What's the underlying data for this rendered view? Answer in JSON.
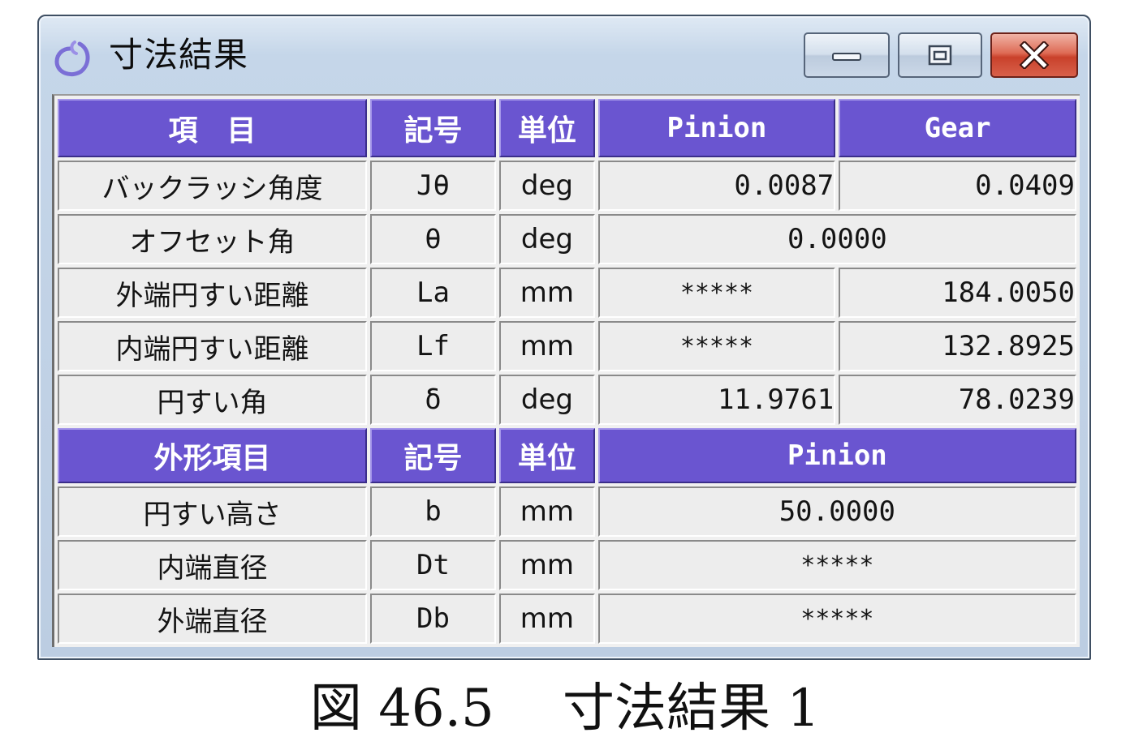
{
  "window": {
    "title": "寸法結果",
    "icon": "app-icon"
  },
  "controls": {
    "minimize": "minimize-icon",
    "maximize": "restore-icon",
    "close": "close-icon"
  },
  "table1": {
    "headers": [
      "項　目",
      "記号",
      "単位",
      "Pinion",
      "Gear"
    ],
    "rows": [
      {
        "item": "バックラッシ角度",
        "symbol": "Jθ",
        "unit": "deg",
        "pinion": "0.0087",
        "gear": "0.0409"
      },
      {
        "item": "オフセット角",
        "symbol": "θ",
        "unit": "deg",
        "merged": "0.0000"
      },
      {
        "item": "外端円すい距離",
        "symbol": "La",
        "unit": "mm",
        "pinion": "*****",
        "gear": "184.0050"
      },
      {
        "item": "内端円すい距離",
        "symbol": "Lf",
        "unit": "mm",
        "pinion": "*****",
        "gear": "132.8925"
      },
      {
        "item": "円すい角",
        "symbol": "δ",
        "unit": "deg",
        "pinion": "11.9761",
        "gear": "78.0239"
      }
    ]
  },
  "table2": {
    "headers": [
      "外形項目",
      "記号",
      "単位",
      "Pinion"
    ],
    "rows": [
      {
        "item": "円すい高さ",
        "symbol": "b",
        "unit": "mm",
        "value": "50.0000"
      },
      {
        "item": "内端直径",
        "symbol": "Dt",
        "unit": "mm",
        "value": "*****"
      },
      {
        "item": "外端直径",
        "symbol": "Db",
        "unit": "mm",
        "value": "*****"
      }
    ]
  },
  "caption": "図 46.5　 寸法結果 1"
}
